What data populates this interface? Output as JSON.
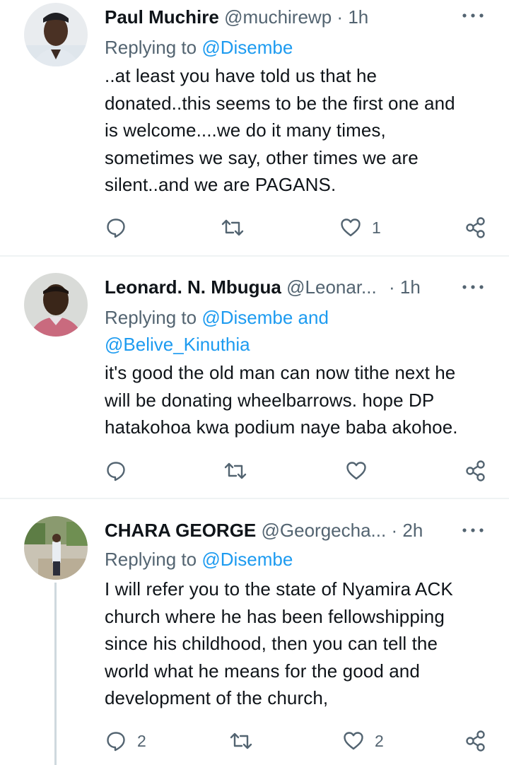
{
  "tweets": [
    {
      "name": "Paul Muchire",
      "handle": "@muchirewp",
      "dot": "·",
      "time": "1h",
      "replying_prefix": "Replying to ",
      "replying_line1": "@Disembe",
      "replying_line2": "",
      "text_lines": [
        "..at least you have told us that he",
        "donated..this seems to be the first one and",
        "is welcome....we do it many times,",
        "sometimes we say, other times we are",
        "silent..and we are PAGANS."
      ],
      "reply_count": "",
      "retweet_count": "",
      "like_count": "1"
    },
    {
      "name": "Leonard. N. Mbugua",
      "handle": "@Leonar...",
      "dot": "·",
      "time": "1h",
      "replying_prefix": "Replying to ",
      "replying_line1": "@Disembe and",
      "replying_line2": "@Belive_Kinuthia",
      "text_lines": [
        "it's good the old man can now tithe next he",
        "will be donating wheelbarrows. hope DP",
        "hatakohoa kwa podium naye baba akohoe."
      ],
      "reply_count": "",
      "retweet_count": "",
      "like_count": ""
    },
    {
      "name": "CHARA GEORGE",
      "handle": "@Georgecha...",
      "dot": "·",
      "time": "2h",
      "replying_prefix": "Replying to ",
      "replying_line1": "@Disembe",
      "replying_line2": "",
      "text_lines": [
        "I will refer you to the state of Nyamira ACK",
        "church where he has been fellowshipping",
        "since his childhood, then you can tell the",
        "world what he means for the good and",
        "development of the church,"
      ],
      "reply_count": "2",
      "retweet_count": "",
      "like_count": "2"
    }
  ],
  "icons": {
    "reply": "reply-icon",
    "retweet": "retweet-icon",
    "like": "heart-icon",
    "share": "share-icon",
    "more": "more-options-icon"
  },
  "colors": {
    "link": "#1d9bf0",
    "secondary_text": "#536471",
    "divider": "#eff3f4",
    "thread_line": "#cfd9de"
  }
}
